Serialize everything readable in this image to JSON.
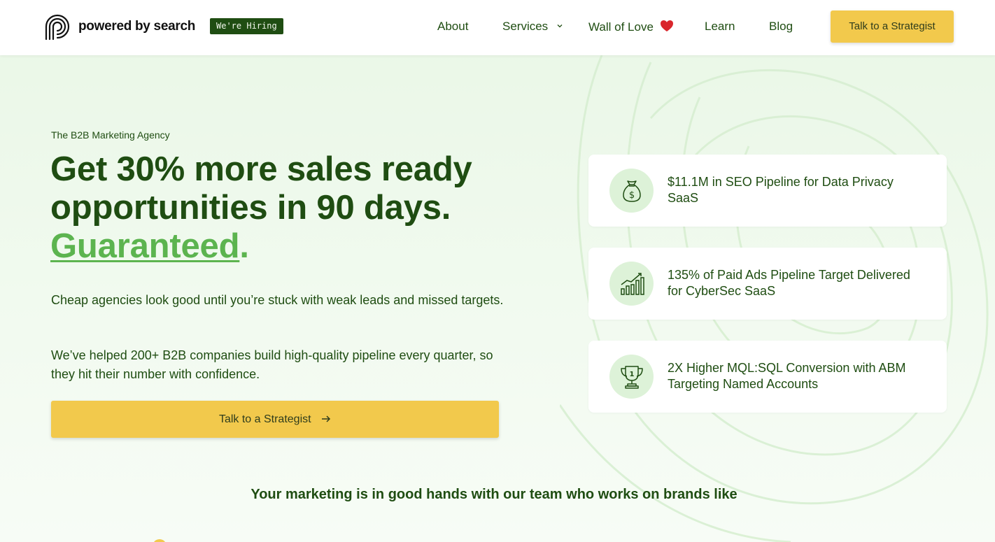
{
  "header": {
    "logo_text": "powered by search",
    "hiring_badge": "We're Hiring",
    "nav": {
      "about": "About",
      "services": "Services",
      "wall_of_love": "Wall of Love",
      "learn": "Learn",
      "blog": "Blog"
    },
    "cta": "Talk to a Strategist"
  },
  "hero": {
    "eyebrow": "The B2B Marketing Agency",
    "headline_line1": "Get 30% more sales ready",
    "headline_line2": "opportunities in 90 days.",
    "headline_accent": "Guaranteed",
    "headline_period": ".",
    "paragraph1": "Cheap agencies look good until you’re stuck with weak leads and missed targets.",
    "paragraph2": "We’ve helped 200+ B2B companies build high-quality pipeline every quarter, so they hit their number with confidence.",
    "cta": "Talk to a Strategist"
  },
  "stats": [
    {
      "icon": "money-bag-icon",
      "text": "$11.1M in SEO Pipeline for Data Privacy SaaS"
    },
    {
      "icon": "growth-chart-icon",
      "text": "135% of Paid Ads Pipeline Target Delivered for CyberSec SaaS"
    },
    {
      "icon": "trophy-icon",
      "text": "2X Higher MQL:SQL Conversion with ABM Targeting Named Accounts"
    }
  ],
  "brands_heading": "Your marketing is in good hands with our team who works on brands like",
  "colors": {
    "brand_green": "#1f4d12",
    "accent_green": "#5cb44f",
    "cta_yellow": "#f2c94c",
    "icon_bg": "#ddf2d8"
  }
}
